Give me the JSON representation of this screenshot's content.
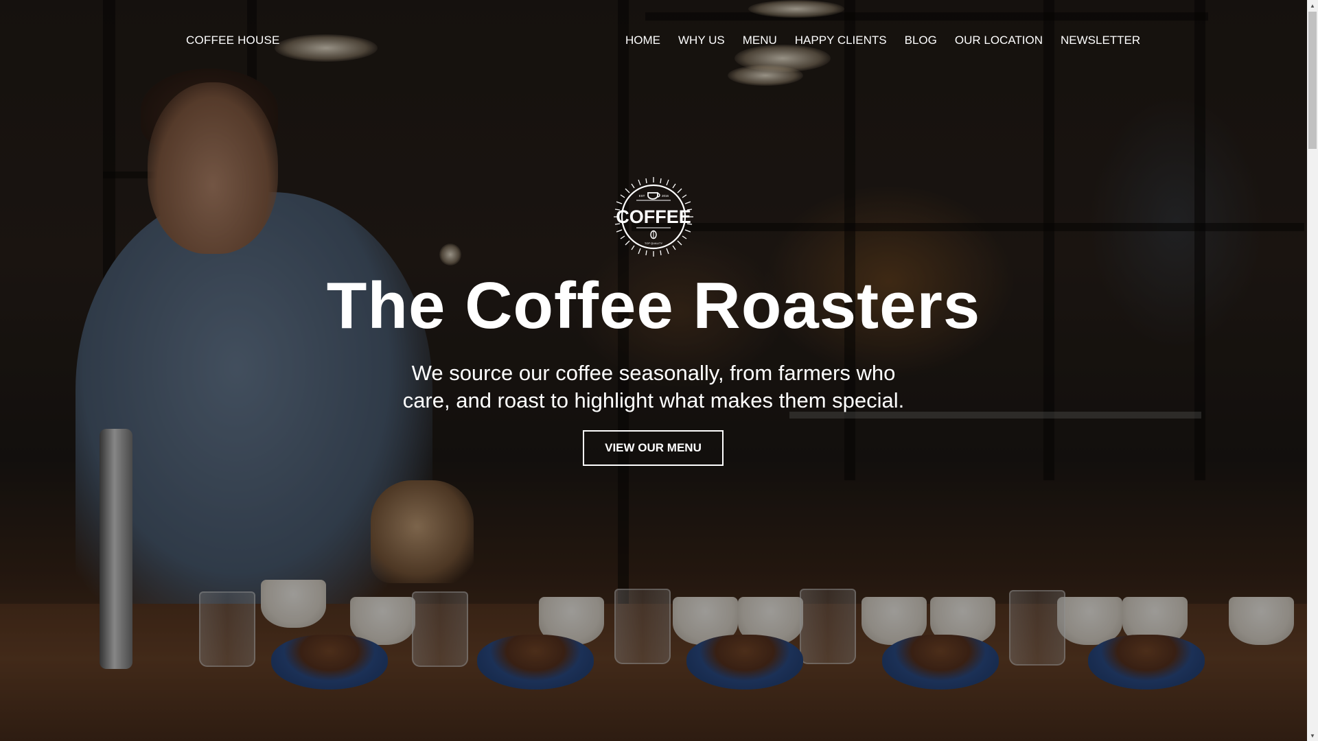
{
  "header": {
    "brand": "COFFEE HOUSE",
    "nav": [
      "HOME",
      "WHY US",
      "MENU",
      "HAPPY CLIENTS",
      "BLOG",
      "OUR LOCATION",
      "NEWSLETTER"
    ]
  },
  "hero": {
    "logo": {
      "main_text": "COFFEE",
      "small_left": "EST",
      "small_right": "2016",
      "bottom_text": "TOP QUALITY",
      "icon": "coffee-cup-icon"
    },
    "title": "The Coffee Roasters",
    "subtitle_line1": "We source our coffee seasonally, from farmers who",
    "subtitle_line2": "care, and roast to highlight what makes them special.",
    "cta_label": "VIEW OUR MENU"
  },
  "colors": {
    "text": "#ffffff",
    "overlay": "#000000",
    "scrollbar_track": "#f1f1f1",
    "scrollbar_thumb": "#c1c1c1"
  }
}
